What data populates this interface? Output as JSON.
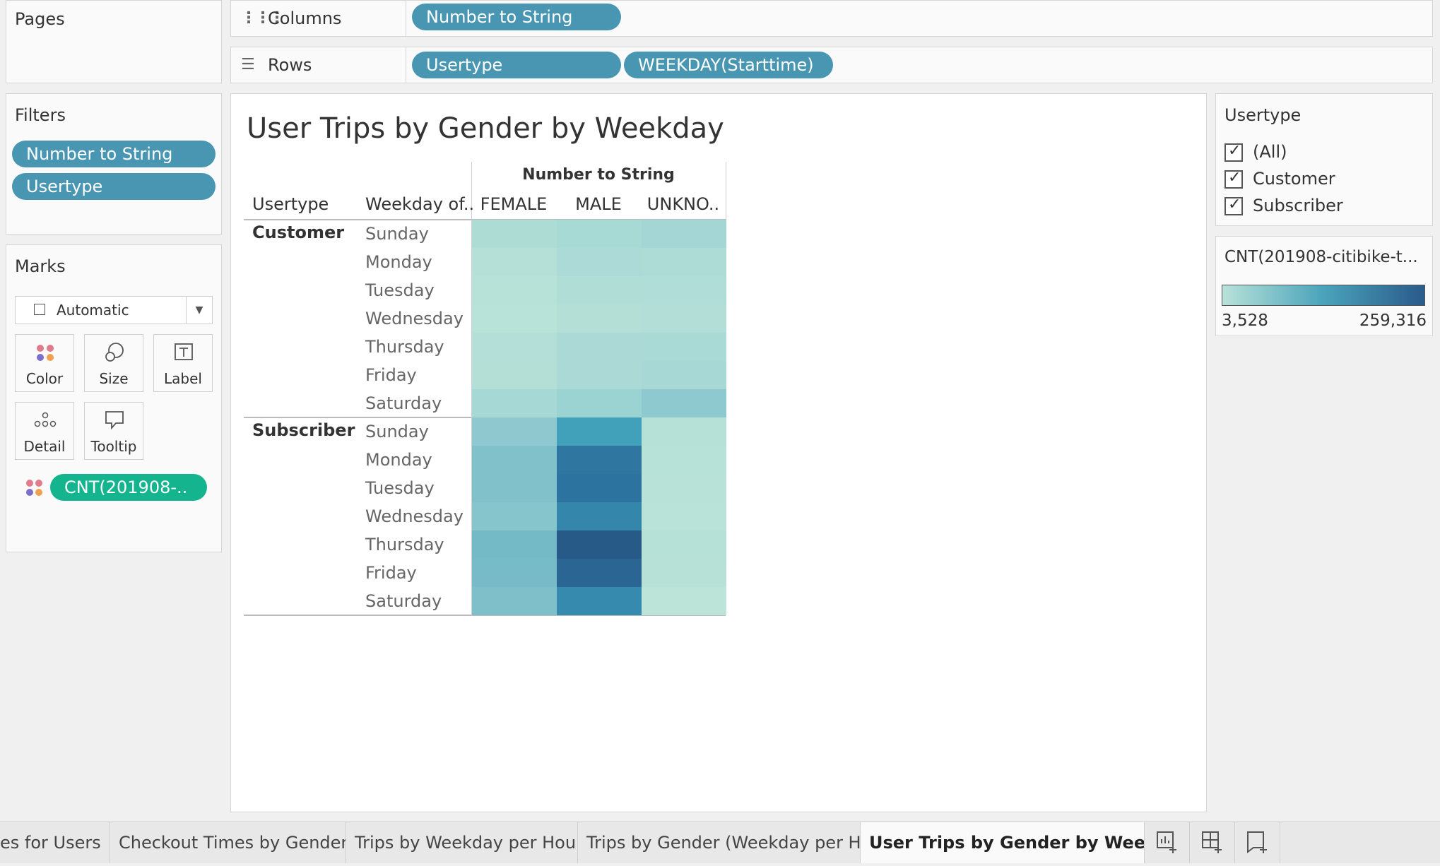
{
  "pages": {
    "title": "Pages"
  },
  "columns_shelf": {
    "label": "Columns",
    "pills": [
      "Number to String"
    ]
  },
  "rows_shelf": {
    "label": "Rows",
    "pills": [
      "Usertype",
      "WEEKDAY(Starttime)"
    ]
  },
  "filters": {
    "title": "Filters",
    "pills": [
      "Number to String",
      "Usertype"
    ]
  },
  "marks": {
    "title": "Marks",
    "type_value": "Automatic",
    "buttons": [
      "Color",
      "Size",
      "Label",
      "Detail",
      "Tooltip"
    ],
    "field_pill": "CNT(201908-.."
  },
  "view": {
    "title": "User Trips by Gender by Weekday",
    "column_group_header": "Number to String",
    "row_header_1": "Usertype",
    "row_header_2": "Weekday of..",
    "columns": [
      "FEMALE",
      "MALE",
      "UNKNO.."
    ],
    "groups": [
      {
        "name": "Customer",
        "days": [
          "Sunday",
          "Monday",
          "Tuesday",
          "Wednesday",
          "Thursday",
          "Friday",
          "Saturday"
        ]
      },
      {
        "name": "Subscriber",
        "days": [
          "Sunday",
          "Monday",
          "Tuesday",
          "Wednesday",
          "Thursday",
          "Friday",
          "Saturday"
        ]
      }
    ]
  },
  "heatmap_colors": {
    "customer": [
      [
        "#addcd5",
        "#a7d9d5",
        "#a3d6d5"
      ],
      [
        "#b4e0d7",
        "#acdad6",
        "#addbd6"
      ],
      [
        "#b7e2d8",
        "#b0ddd6",
        "#b0ddd7"
      ],
      [
        "#b8e3d9",
        "#b3dfd7",
        "#b2ded7"
      ],
      [
        "#b3dfd8",
        "#abdad6",
        "#aadad6"
      ],
      [
        "#b3dfd7",
        "#aad9d6",
        "#a8d8d5"
      ],
      [
        "#a6d8d5",
        "#9bd3d3",
        "#8dc9ce"
      ]
    ],
    "subscriber": [
      [
        "#8fc9cf",
        "#41a0ba",
        "#b6e1d7"
      ],
      [
        "#80c1ca",
        "#2f77a1",
        "#b7e2d8"
      ],
      [
        "#81c2ca",
        "#2d73a0",
        "#b8e2d8"
      ],
      [
        "#86c5cc",
        "#3486ab",
        "#b9e2d8"
      ],
      [
        "#74b9c6",
        "#285a88",
        "#b6e1d7"
      ],
      [
        "#76bbc7",
        "#2b6593",
        "#b7e1d7"
      ],
      [
        "#7ebfc9",
        "#358aae",
        "#bde4d9"
      ]
    ]
  },
  "usertype_filter": {
    "title": "Usertype",
    "options": [
      "(All)",
      "Customer",
      "Subscriber"
    ]
  },
  "legend": {
    "title": "CNT(201908-citibike-t...",
    "min_label": "3,528",
    "max_label": "259,316",
    "color_low": "#b8e2d9",
    "color_high": "#2a5a8a"
  },
  "tabs": [
    "es for Users",
    "Checkout Times by Gender",
    "Trips by Weekday per Hour",
    "Trips by Gender (Weekday per H...",
    "User Trips by Gender by Weekd..."
  ]
}
